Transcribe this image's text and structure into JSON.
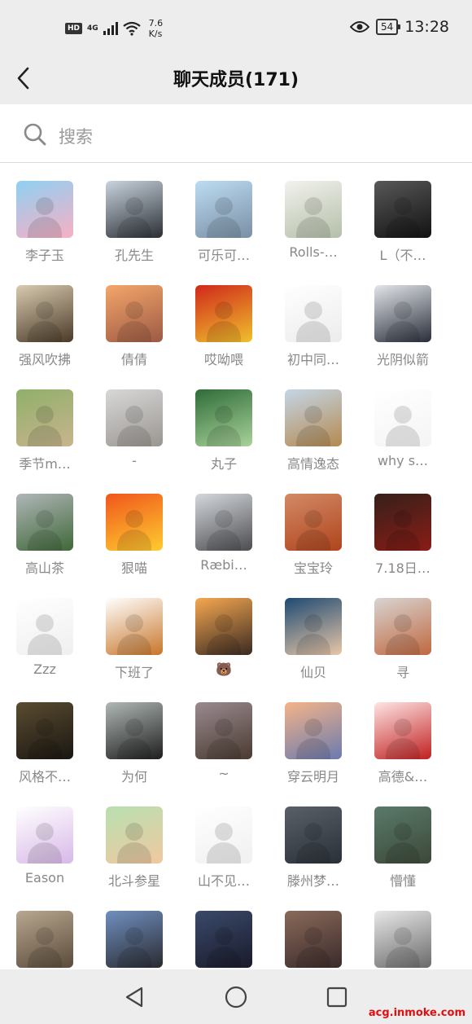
{
  "status_bar": {
    "hd": "HD",
    "network": "4G",
    "speed_value": "7.6",
    "speed_unit": "K/s",
    "battery": "54",
    "time": "13:28"
  },
  "header": {
    "title": "聊天成员(171)",
    "back_icon": "chevron-left-icon"
  },
  "search": {
    "placeholder": "搜索",
    "icon": "search-icon"
  },
  "members": [
    {
      "name": "李子玉",
      "colors": [
        "#8fd0f2",
        "#f8b0c4"
      ]
    },
    {
      "name": "孔先生",
      "colors": [
        "#c9d4de",
        "#2b2f35"
      ]
    },
    {
      "name": "可乐可…",
      "colors": [
        "#bcdcf2",
        "#7a8fa5"
      ]
    },
    {
      "name": "Rolls-…",
      "colors": [
        "#f2f2ee",
        "#b4bfa8"
      ]
    },
    {
      "name": "L（不…",
      "colors": [
        "#585858",
        "#121212"
      ]
    },
    {
      "name": "强风吹拂",
      "colors": [
        "#d8cbb0",
        "#4a3a28"
      ]
    },
    {
      "name": "倩倩",
      "colors": [
        "#f4a66a",
        "#9c5a44"
      ]
    },
    {
      "name": "哎呦喂",
      "colors": [
        "#d0281c",
        "#f0c02c"
      ]
    },
    {
      "name": "初中同…",
      "colors": [
        "#ffffff",
        "#ececec"
      ]
    },
    {
      "name": "光阴似箭",
      "colors": [
        "#e2e6ea",
        "#2a2e3a"
      ]
    },
    {
      "name": "季节m…",
      "colors": [
        "#8fb06a",
        "#c9b48e"
      ]
    },
    {
      "name": "-",
      "colors": [
        "#d8d8d8",
        "#9a9590"
      ]
    },
    {
      "name": "丸子",
      "colors": [
        "#2f6c38",
        "#a9d29a"
      ]
    },
    {
      "name": "高情逸态",
      "colors": [
        "#c4d6e8",
        "#b48a50"
      ]
    },
    {
      "name": "why s…",
      "colors": [
        "#ffffff",
        "#f4f4f4"
      ]
    },
    {
      "name": "高山茶",
      "colors": [
        "#b0b6b8",
        "#3f6838"
      ]
    },
    {
      "name": "狠喵",
      "colors": [
        "#f0561c",
        "#ffcc30"
      ]
    },
    {
      "name": "Ræbi…",
      "colors": [
        "#d4d8dc",
        "#4c4c50"
      ]
    },
    {
      "name": "宝宝玲",
      "colors": [
        "#d28a66",
        "#b0441c"
      ]
    },
    {
      "name": "7.18日…",
      "colors": [
        "#36201a",
        "#8a1c16"
      ]
    },
    {
      "name": "Zzz",
      "colors": [
        "#ffffff",
        "#efefef"
      ]
    },
    {
      "name": "下班了",
      "colors": [
        "#ffffff",
        "#c8762a"
      ]
    },
    {
      "name": "🐻",
      "colors": [
        "#f6a850",
        "#3a2a22"
      ]
    },
    {
      "name": "仙贝",
      "colors": [
        "#1e4a72",
        "#e8c6a8"
      ]
    },
    {
      "name": "寻",
      "colors": [
        "#d8d4d2",
        "#c06840"
      ]
    },
    {
      "name": "风格不…",
      "colors": [
        "#5a4c30",
        "#1a1612"
      ]
    },
    {
      "name": "为何",
      "colors": [
        "#b0b8b4",
        "#1e1e1e"
      ]
    },
    {
      "name": "~",
      "colors": [
        "#9a8a90",
        "#4a3a30"
      ]
    },
    {
      "name": "穿云明月",
      "colors": [
        "#f4b488",
        "#6a7ab0"
      ]
    },
    {
      "name": "高德&…",
      "colors": [
        "#ffe4e4",
        "#c02020"
      ]
    },
    {
      "name": "Eason",
      "colors": [
        "#ffffff",
        "#d8b8e8"
      ]
    },
    {
      "name": "北斗参星",
      "colors": [
        "#b8e0b0",
        "#f0c8a0"
      ]
    },
    {
      "name": "山不见…",
      "colors": [
        "#ffffff",
        "#f0f0f0"
      ]
    },
    {
      "name": "滕州梦…",
      "colors": [
        "#5a6068",
        "#2a3038"
      ]
    },
    {
      "name": "懵懂",
      "colors": [
        "#5a7a6a",
        "#3c4838"
      ]
    },
    {
      "name": "",
      "colors": [
        "#b8a890",
        "#5a4a3a"
      ]
    },
    {
      "name": "",
      "colors": [
        "#7090c0",
        "#2a2a30"
      ]
    },
    {
      "name": "",
      "colors": [
        "#3a4a6a",
        "#1a1a2a"
      ]
    },
    {
      "name": "",
      "colors": [
        "#8a6a5a",
        "#3a2a2a"
      ]
    },
    {
      "name": "",
      "colors": [
        "#e8e8e8",
        "#6a6a6a"
      ]
    }
  ],
  "nav_bar": {
    "back_icon": "triangle-back-icon",
    "home_icon": "circle-home-icon",
    "recents_icon": "square-recents-icon"
  },
  "watermark": "acg.inmoke.com"
}
